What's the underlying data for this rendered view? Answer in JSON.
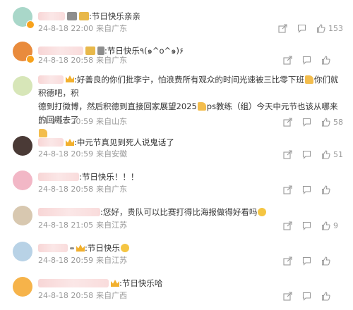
{
  "comments": [
    {
      "text": ":节日快乐亲亲",
      "time": "24-8-18 22:00",
      "location": "来自广东",
      "likes": "153",
      "avatar_color": "#a9d7c9"
    },
    {
      "text": ":节日快乐٩(๑^o^๑)۶",
      "time": "24-8-18 20:58",
      "location": "来自广东",
      "likes": "",
      "avatar_color": "#e98b3c"
    },
    {
      "text": ":好善良的你们批李宁，怕浪费所有观众的时间光速被三比零下班",
      "text2": "你们就积德吧，积",
      "text3": "德到打微博，然后积德到直接回家展望2025",
      "text4": "ps教练（组）今天中元节也该从哪来的回哪去了",
      "time": "24-8-18 20:59",
      "location": "来自山东",
      "likes": "58",
      "avatar_color": "#d7e6b8"
    },
    {
      "text": ":中元节真见到死人说鬼话了",
      "time": "24-8-18 20:59",
      "location": "来自安徽",
      "likes": "51",
      "avatar_color": "#4a3a36"
    },
    {
      "text": ":节日快乐！！！",
      "time": "24-8-18 20:58",
      "location": "来自广东",
      "likes": "",
      "avatar_color": "#f2b7c6"
    },
    {
      "text": ":您好，贵队可以比赛打得比海报做得好看吗",
      "time": "24-8-18 21:05",
      "location": "来自江苏",
      "likes": "9",
      "avatar_color": "#d8c8b0"
    },
    {
      "text": ":节日快乐",
      "time": "24-8-18 20:59",
      "location": "来自江苏",
      "likes": "",
      "avatar_color": "#b8d2e6"
    },
    {
      "text": ":节日快乐哈",
      "time": "24-8-18 20:58",
      "location": "来自广西",
      "likes": "",
      "avatar_color": "#f6b34a"
    }
  ],
  "icons": {
    "share": "share-icon",
    "comment": "comment-icon",
    "like": "thumbs-up-icon"
  },
  "colors": {
    "text": "#333333",
    "meta": "#999999",
    "name_blur": "#f8d6d6",
    "vip_badge": "#f7a21c"
  }
}
